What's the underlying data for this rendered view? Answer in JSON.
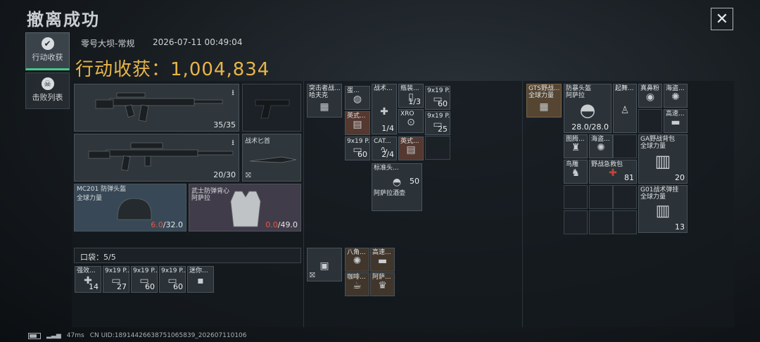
{
  "header": {
    "title": "撤离成功",
    "close_glyph": "✕"
  },
  "tabs": [
    {
      "label": "行动收获",
      "icon": "check-circle-icon",
      "active": true
    },
    {
      "label": "击败列表",
      "icon": "skull-icon",
      "active": false
    }
  ],
  "meta": {
    "map_mode": "零号大坝-常规",
    "timestamp": "2026-07-11 00:49:04"
  },
  "yield": {
    "label": "行动收获：",
    "value": "1,004,834"
  },
  "loadout": {
    "primary": {
      "ammo": "35/35",
      "icon": "assault-rifle-icon"
    },
    "pistol": {
      "icon": "pistol-icon"
    },
    "secondary": {
      "ammo": "20/30",
      "icon": "rifle-scoped-icon"
    },
    "melee": {
      "label": "战术匕首",
      "icon": "knife-icon"
    },
    "helmet": {
      "name": "MC201 防弹头盔",
      "sub": "全球力量",
      "cur": "6.0",
      "max": "/32.0"
    },
    "armor": {
      "name": "武士防弹背心",
      "sub": "阿萨拉",
      "cur": "0.0",
      "max": "/49.0"
    },
    "pocket": {
      "label": "口袋：",
      "count": "5",
      "cap": "/5"
    },
    "pocket_items": [
      {
        "label": "强效...",
        "count": "14"
      },
      {
        "label": "9x19 P...",
        "count": "27"
      },
      {
        "label": "9x19 P...",
        "count": "60"
      },
      {
        "label": "9x19 P...",
        "count": "60"
      },
      {
        "label": "迷你...",
        "count": ""
      }
    ]
  },
  "rig": {
    "items": [
      {
        "label": "突击者战...",
        "sub": "哈夫克",
        "count": ""
      },
      {
        "label": "蛋...",
        "count": ""
      },
      {
        "label": "战术...",
        "count": "1/4"
      },
      {
        "label": "瓶装...",
        "count": "1/3"
      },
      {
        "label": "9x19 P...",
        "count": "60"
      },
      {
        "label": "英式...",
        "count": ""
      },
      {
        "label": "XRO",
        "count": ""
      },
      {
        "label": "9x19 P...",
        "count": "25"
      },
      {
        "label": "9x19 P...",
        "count": "60"
      },
      {
        "label": "CAT...",
        "count": "2/4"
      },
      {
        "label": "英式...",
        "count": ""
      },
      {
        "label": "标准头...",
        "sub": "阿萨拉酒壶",
        "count": "50"
      }
    ]
  },
  "pouch": {
    "items": [
      {
        "label": "八角...",
        "count": ""
      },
      {
        "label": "高速...",
        "count": ""
      },
      {
        "label": "咖啡...",
        "count": ""
      },
      {
        "label": "阿萨...",
        "count": ""
      }
    ]
  },
  "backpack": {
    "items": [
      {
        "label": "GTS野战...",
        "sub": "全球力量",
        "count": ""
      },
      {
        "label": "防暴头盔",
        "sub": "阿萨拉",
        "count": "28.0/28.0"
      },
      {
        "label": "起舞...",
        "count": ""
      },
      {
        "label": "真鼻粉",
        "count": ""
      },
      {
        "label": "海盗...",
        "count": ""
      },
      {
        "label": "高速...",
        "count": ""
      },
      {
        "label": "图腾...",
        "count": ""
      },
      {
        "label": "海盗...",
        "count": ""
      },
      {
        "label": "GA野战背包",
        "sub": "全球力量",
        "count": "20"
      },
      {
        "label": "鸟雕",
        "count": ""
      },
      {
        "label": "野战急救包",
        "count": "81"
      },
      {
        "label": "G01战术弹挂",
        "sub": "全球力量",
        "count": "13"
      }
    ]
  },
  "status": {
    "ping": "47ms",
    "uid": "CN UID:1891442663875106583​9_202607110106"
  },
  "colors": {
    "accent": "#e8b548",
    "active_tab": "#41c98c",
    "damage": "#e05a4a"
  }
}
